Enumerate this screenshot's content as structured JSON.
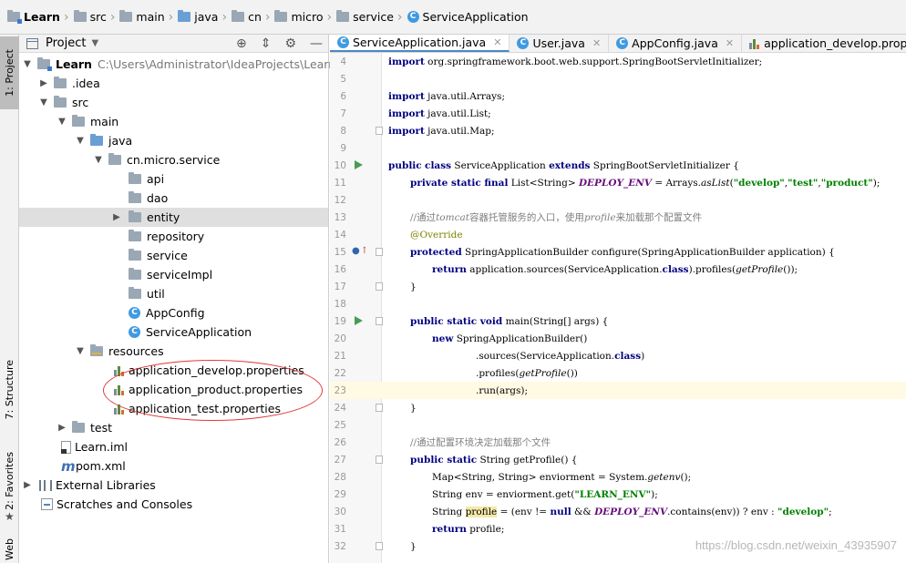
{
  "breadcrumb": [
    "Learn",
    "src",
    "main",
    "java",
    "cn",
    "micro",
    "service",
    "ServiceApplication"
  ],
  "left_toolbar": {
    "project": "1: Project",
    "structure": "7: Structure",
    "favorites": "2: Favorites",
    "web": "Web"
  },
  "project_panel": {
    "title": "Project"
  },
  "tree": [
    {
      "label": "Learn",
      "sub": "C:\\Users\\Administrator\\IdeaProjects\\Learn",
      "icon": "module-folder-icon",
      "arrow": "down"
    },
    {
      "label": ".idea",
      "icon": "folder-icon",
      "arrow": "right"
    },
    {
      "label": "src",
      "icon": "folder-icon",
      "arrow": "down"
    },
    {
      "label": "main",
      "icon": "folder-icon",
      "arrow": "down"
    },
    {
      "label": "java",
      "icon": "source-folder-icon",
      "arrow": "down"
    },
    {
      "label": "cn.micro.service",
      "icon": "package-icon",
      "arrow": "down"
    },
    {
      "label": "api",
      "icon": "package-icon",
      "arrow": ""
    },
    {
      "label": "dao",
      "icon": "package-icon",
      "arrow": ""
    },
    {
      "label": "entity",
      "icon": "package-icon",
      "arrow": "right"
    },
    {
      "label": "repository",
      "icon": "package-icon",
      "arrow": ""
    },
    {
      "label": "service",
      "icon": "package-icon",
      "arrow": ""
    },
    {
      "label": "serviceImpl",
      "icon": "package-icon",
      "arrow": ""
    },
    {
      "label": "util",
      "icon": "package-icon",
      "arrow": ""
    },
    {
      "label": "AppConfig",
      "icon": "class-icon",
      "arrow": ""
    },
    {
      "label": "ServiceApplication",
      "icon": "class-icon",
      "arrow": ""
    },
    {
      "label": "resources",
      "icon": "resources-folder-icon",
      "arrow": "down"
    },
    {
      "label": "application_develop.properties",
      "icon": "properties-icon",
      "arrow": ""
    },
    {
      "label": "application_product.properties",
      "icon": "properties-icon",
      "arrow": ""
    },
    {
      "label": "application_test.properties",
      "icon": "properties-icon",
      "arrow": ""
    },
    {
      "label": "test",
      "icon": "folder-icon",
      "arrow": "right"
    },
    {
      "label": "Learn.iml",
      "icon": "iml-file-icon",
      "arrow": ""
    },
    {
      "label": "pom.xml",
      "icon": "maven-icon",
      "arrow": ""
    },
    {
      "label": "External Libraries",
      "icon": "library-icon",
      "arrow": "right"
    },
    {
      "label": "Scratches and Consoles",
      "icon": "scratches-icon",
      "arrow": ""
    }
  ],
  "tabs": [
    {
      "label": "ServiceApplication.java",
      "icon": "class-icon",
      "active": true
    },
    {
      "label": "User.java",
      "icon": "class-icon",
      "active": false
    },
    {
      "label": "AppConfig.java",
      "icon": "class-icon",
      "active": false
    },
    {
      "label": "application_develop.properties",
      "icon": "properties-icon",
      "active": false
    }
  ],
  "code": {
    "line_numbers": [
      "4",
      "5",
      "6",
      "7",
      "8",
      "9",
      "10",
      "11",
      "12",
      "13",
      "14",
      "15",
      "16",
      "17",
      "18",
      "19",
      "20",
      "21",
      "22",
      "23",
      "24",
      "25",
      "26",
      "27",
      "28",
      "29",
      "30",
      "31",
      "32"
    ],
    "t4_import": "import",
    "t4_rest": " org.springframework.boot.web.support.SpringBootServletInitializer;",
    "t6_import": "import",
    "t6_rest": " java.util.Arrays;",
    "t7_import": "import",
    "t7_rest": " java.util.List;",
    "t8_import": "import",
    "t8_rest": " java.util.Map;",
    "t10_public": "public",
    "t10_class": "class",
    "t10_name": " ServiceApplication ",
    "t10_extends": "extends",
    "t10_rest": " SpringBootServletInitializer {",
    "t11_mods": "private static final",
    "t11_type": " List<String> ",
    "t11_field": "DEPLOY_ENV",
    "t11_eq": " = Arrays.",
    "t11_method": "asList",
    "t11_open": "(",
    "t11_s1": "\"develop\"",
    "t11_c1": ",",
    "t11_s2": "\"test\"",
    "t11_c2": ",",
    "t11_s3": "\"product\"",
    "t11_end": ");",
    "t13_a": "//通过",
    "t13_b": "tomcat",
    "t13_c": "容器托管服务的入口，使用",
    "t13_d": "profile",
    "t13_e": "来加载那个配置文件",
    "t14_annot": "@Override",
    "t15_protected": "protected",
    "t15_rest": " SpringApplicationBuilder configure(SpringApplicationBuilder application) {",
    "t16_return": "return",
    "t16_a": " application.sources(ServiceApplication.",
    "t16_class": "class",
    "t16_b": ").profiles(",
    "t16_call": "getProfile",
    "t16_c": "());",
    "t17": "}",
    "t19_mods": "public static void",
    "t19_rest": " main(String[] args) {",
    "t20_new": "new",
    "t20_rest": " SpringApplicationBuilder()",
    "t21_a": ".sources(ServiceApplication.",
    "t21_class": "class",
    "t21_b": ")",
    "t22_a": ".profiles(",
    "t22_call": "getProfile",
    "t22_b": "())",
    "t23": ".run(args);",
    "t24": "}",
    "t26": "//通过配置环境决定加载那个文件",
    "t27_mods": "public static",
    "t27_rest": " String getProfile() {",
    "t28_a": "Map<String, String> enviorment = System.",
    "t28_call": "getenv",
    "t28_b": "();",
    "t29_a": "String env = enviorment.get(",
    "t29_s": "\"LEARN_ENV\"",
    "t29_b": ");",
    "t30_a": "String ",
    "t30_hl": "profile",
    "t30_b": " = (env != ",
    "t30_null": "null",
    "t30_c": " && ",
    "t30_field": "DEPLOY_ENV",
    "t30_d": ".contains(env)) ? env : ",
    "t30_s": "\"develop\"",
    "t30_e": ";",
    "t31_return": "return",
    "t31_rest": " profile;",
    "t32": "}"
  },
  "watermark": "https://blog.csdn.net/weixin_43935907"
}
